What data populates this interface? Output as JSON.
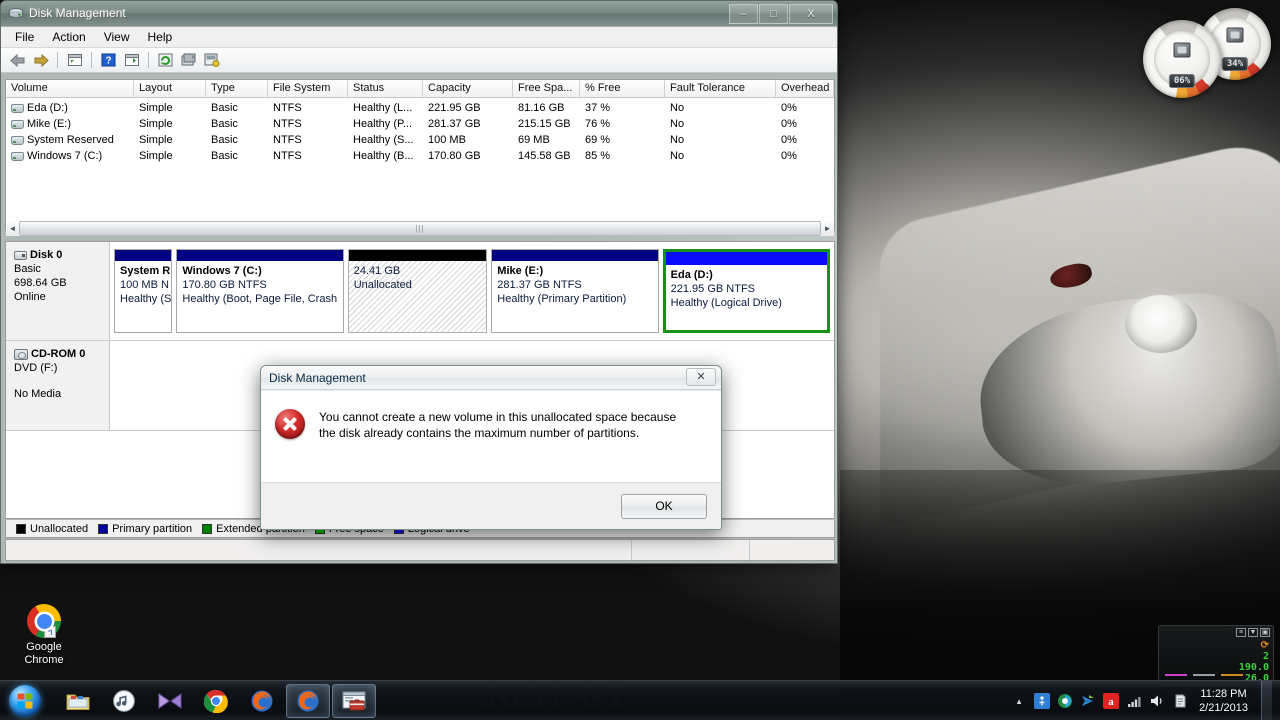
{
  "window": {
    "title": "Disk Management",
    "icon": "disk-management-icon",
    "minimize_label": "–",
    "maximize_label": "□",
    "close_label": "X",
    "menu": [
      "File",
      "Action",
      "View",
      "Help"
    ],
    "toolbar": [
      {
        "name": "back-icon",
        "glyph": "◄"
      },
      {
        "name": "forward-icon",
        "glyph": "►"
      },
      {
        "name": "up-one-level-icon",
        "glyph": "▤"
      },
      {
        "name": "help-icon",
        "glyph": "?"
      },
      {
        "name": "show-console-tree-icon",
        "glyph": "▤"
      },
      {
        "name": "refresh-icon",
        "glyph": "↻"
      },
      {
        "name": "properties-icon",
        "glyph": "▦"
      },
      {
        "name": "rescan-disks-icon",
        "glyph": "▩"
      }
    ]
  },
  "volume_list": {
    "columns": [
      "Volume",
      "Layout",
      "Type",
      "File System",
      "Status",
      "Capacity",
      "Free Spa...",
      "% Free",
      "Fault Tolerance",
      "Overhead"
    ],
    "rows": [
      {
        "volume": "Eda (D:)",
        "layout": "Simple",
        "type": "Basic",
        "fs": "NTFS",
        "status": "Healthy (L...",
        "capacity": "221.95 GB",
        "free": "81.16 GB",
        "pctfree": "37 %",
        "fault": "No",
        "overhead": "0%"
      },
      {
        "volume": "Mike (E:)",
        "layout": "Simple",
        "type": "Basic",
        "fs": "NTFS",
        "status": "Healthy (P...",
        "capacity": "281.37 GB",
        "free": "215.15 GB",
        "pctfree": "76 %",
        "fault": "No",
        "overhead": "0%"
      },
      {
        "volume": "System Reserved",
        "layout": "Simple",
        "type": "Basic",
        "fs": "NTFS",
        "status": "Healthy (S...",
        "capacity": "100 MB",
        "free": "69 MB",
        "pctfree": "69 %",
        "fault": "No",
        "overhead": "0%"
      },
      {
        "volume": "Windows 7 (C:)",
        "layout": "Simple",
        "type": "Basic",
        "fs": "NTFS",
        "status": "Healthy (B...",
        "capacity": "170.80 GB",
        "free": "145.58 GB",
        "pctfree": "85 %",
        "fault": "No",
        "overhead": "0%"
      }
    ]
  },
  "graphical_view": {
    "disks": [
      {
        "name": "Disk 0",
        "type": "Basic",
        "size": "698.64 GB",
        "state": "Online",
        "partitions": [
          {
            "title": "System R",
            "line2": "100 MB N",
            "line3": "Healthy (S",
            "cap_color": "#000080",
            "selected": false,
            "unallocated": false,
            "width_pct": 8.2
          },
          {
            "title": "Windows 7  (C:)",
            "line2": "170.80 GB NTFS",
            "line3": "Healthy (Boot, Page File, Crash",
            "cap_color": "#000080",
            "selected": false,
            "unallocated": false,
            "width_pct": 23.5
          },
          {
            "title": "",
            "line2": "24.41 GB",
            "line3": "Unallocated",
            "cap_color": "#000000",
            "selected": false,
            "unallocated": true,
            "width_pct": 19.6
          },
          {
            "title": "Mike  (E:)",
            "line2": "281.37 GB NTFS",
            "line3": "Healthy (Primary Partition)",
            "cap_color": "#000080",
            "selected": false,
            "unallocated": false,
            "width_pct": 23.5
          },
          {
            "title": "Eda  (D:)",
            "line2": "221.95 GB NTFS",
            "line3": "Healthy (Logical Drive)",
            "cap_color": "#0a0aff",
            "selected": true,
            "unallocated": false,
            "width_pct": 23.5
          }
        ]
      },
      {
        "name": "CD-ROM 0",
        "type": "DVD (F:)",
        "size": "",
        "state": "No Media",
        "partitions": []
      }
    ]
  },
  "legend": [
    {
      "label": "Unallocated",
      "color": "#000000"
    },
    {
      "label": "Primary partition",
      "color": "#0000a0"
    },
    {
      "label": "Extended partition",
      "color": "#008000"
    },
    {
      "label": "Free space",
      "color": "#00cc00"
    },
    {
      "label": "Logical drive",
      "color": "#1818ff"
    }
  ],
  "dialog": {
    "title": "Disk Management",
    "close_label": "✕",
    "message": "You cannot create a new volume in this unallocated space because the disk already contains the maximum number of partitions.",
    "ok_label": "OK",
    "icon": "error-icon"
  },
  "desktop": {
    "icon_label_line1": "Google",
    "icon_label_line2": "Chrome",
    "wallpaper_text": "JUST GT"
  },
  "gadgets": {
    "cpu_value": "06%",
    "memory_value": "34%",
    "network": {
      "line1": "2",
      "line2": "190.0",
      "line3": "26.0"
    }
  },
  "taskbar": {
    "start_label": "Start",
    "items": [
      {
        "name": "taskbar-explorer",
        "icon": "folder-icon",
        "active": false
      },
      {
        "name": "taskbar-itunes",
        "icon": "music-note-icon",
        "active": false
      },
      {
        "name": "taskbar-mpc",
        "icon": "media-player-icon",
        "active": false
      },
      {
        "name": "taskbar-chrome",
        "icon": "chrome-icon",
        "active": false
      },
      {
        "name": "taskbar-firefox",
        "icon": "firefox-icon",
        "active": false
      },
      {
        "name": "taskbar-firefox-2",
        "icon": "firefox-icon",
        "active": true
      },
      {
        "name": "taskbar-diskmgmt",
        "icon": "disk-management-icon",
        "active": true
      }
    ],
    "tray": [
      {
        "name": "tray-show-hidden-icon",
        "glyph": "▲"
      },
      {
        "name": "tray-network-center-icon",
        "glyph": "i"
      },
      {
        "name": "tray-idm-icon",
        "glyph": "◉"
      },
      {
        "name": "tray-download-icon",
        "glyph": "➤"
      },
      {
        "name": "tray-avira-icon",
        "glyph": "ɑ"
      },
      {
        "name": "tray-network-icon",
        "glyph": "▮"
      },
      {
        "name": "tray-volume-icon",
        "glyph": "◀"
      },
      {
        "name": "tray-action-center-icon",
        "glyph": "▤"
      }
    ],
    "clock_time": "11:28 PM",
    "clock_date": "2/21/2013"
  }
}
